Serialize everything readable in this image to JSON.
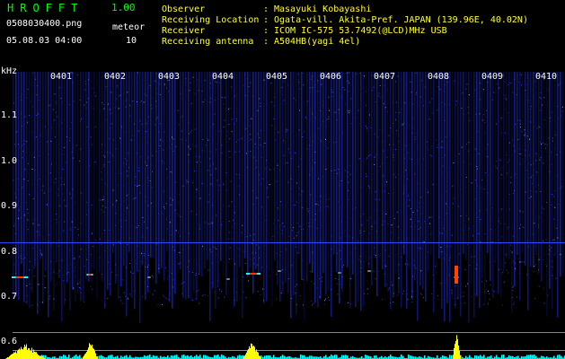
{
  "app": {
    "title": "HROFFT",
    "version": "1.00"
  },
  "file": {
    "name": "0508030400.png",
    "datetime": "05.08.03 04:00"
  },
  "meteor": {
    "label": "meteor",
    "count": "10"
  },
  "info": [
    {
      "label": "Observer",
      "value": "Masayuki Kobayashi"
    },
    {
      "label": "Receiving Location",
      "value": "Ogata-vill. Akita-Pref. JAPAN (139.96E, 40.02N)"
    },
    {
      "label": "Receiver",
      "value": "ICOM IC-575 53.7492(@LCD)MHz USB"
    },
    {
      "label": "Receiving antenna",
      "value": "A504HB(yagi 4el)"
    }
  ],
  "separator": ":",
  "spectrogram": {
    "y_unit": "kHz",
    "y_ticks": [
      "1.1",
      "1.0",
      "0.9",
      "0.8",
      "0.7",
      "0.6"
    ],
    "x_ticks": [
      "0401",
      "0402",
      "0403",
      "0404",
      "0405",
      "0406",
      "0407",
      "0408",
      "0409",
      "0410"
    ],
    "colors": {
      "background": "#000000",
      "noise": "#1a2bd8",
      "echo": "#ff3300",
      "histogram": "#ffff00",
      "baseline": "#00ffff",
      "header_text": "#00ff00"
    }
  }
}
